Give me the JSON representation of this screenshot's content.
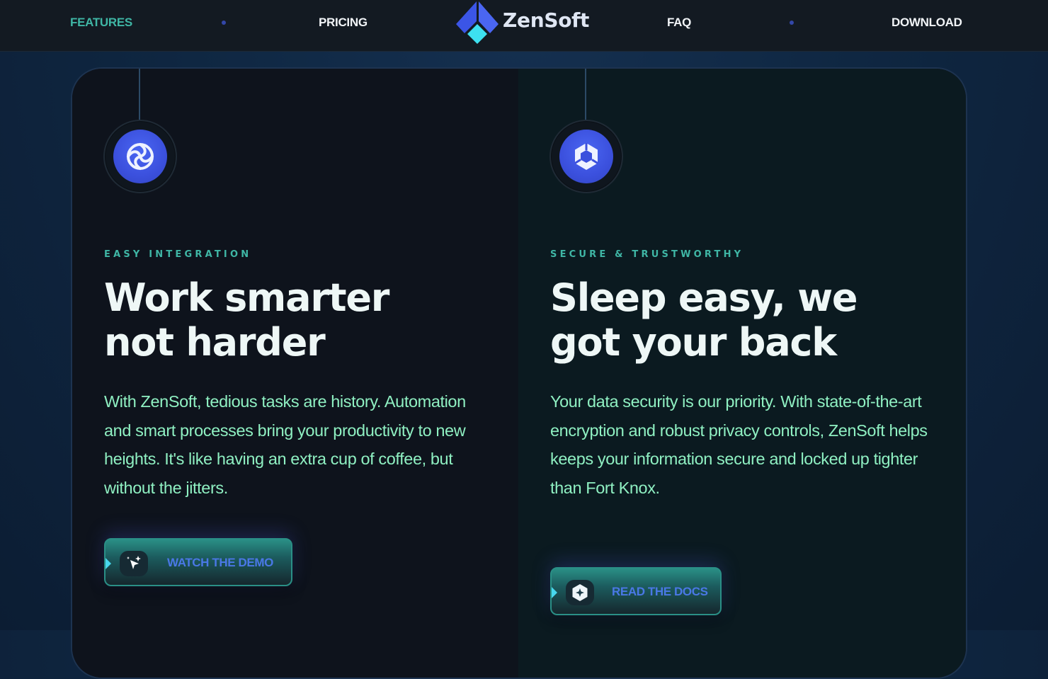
{
  "nav": {
    "links": [
      "FEATURES",
      "PRICING",
      "FAQ",
      "DOWNLOAD"
    ],
    "active": "FEATURES",
    "brand": "ZenSoft"
  },
  "features": [
    {
      "eyebrow": "EASY INTEGRATION",
      "headline_line1": "Work smarter",
      "headline_line2": "not harder",
      "body": "With ZenSoft, tedious tasks are history. Automation and smart processes bring your productivity to new heights. It's like having an extra cup of coffee, but without the jitters.",
      "cta_label": "WATCH THE DEMO",
      "icon": "swirl-icon",
      "cta_icon": "sparkle-cursor-icon"
    },
    {
      "eyebrow": "SECURE & TRUSTWORTHY",
      "headline_line1": "Sleep easy, we",
      "headline_line2": "got your back",
      "body": "Your data security is our priority. With state-of-the-art encryption and robust privacy controls, ZenSoft helps keeps your information secure and locked up tighter than Fort Knox.",
      "cta_label": "READ THE DOCS",
      "icon": "hexagon-shield-icon",
      "cta_icon": "docs-badge-icon"
    }
  ],
  "colors": {
    "accent_teal": "#3fb6a5",
    "body_text": "#8ff0c2",
    "icon_blue": "#3b50dd",
    "cta_label": "#4a78e6"
  }
}
